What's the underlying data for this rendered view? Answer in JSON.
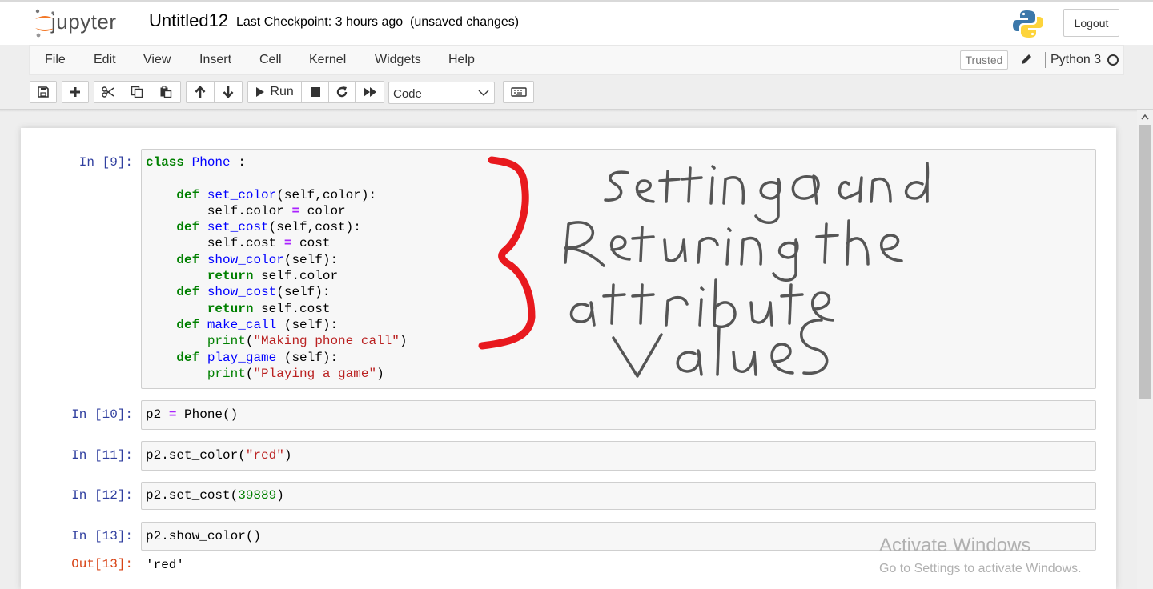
{
  "header": {
    "app_name": "jupyter",
    "notebook_title": "Untitled12",
    "checkpoint_text": "Last Checkpoint: 3 hours ago",
    "unsaved_text": "(unsaved changes)",
    "logout_label": "Logout"
  },
  "menu": {
    "items": [
      "File",
      "Edit",
      "View",
      "Insert",
      "Cell",
      "Kernel",
      "Widgets",
      "Help"
    ],
    "trusted_label": "Trusted",
    "kernel_name": "Python 3"
  },
  "toolbar": {
    "run_label": "Run",
    "cell_type": "Code",
    "icons": [
      "save-icon",
      "plus-icon",
      "scissors-icon",
      "copy-icon",
      "paste-icon",
      "arrow-up-icon",
      "arrow-down-icon",
      "play-icon",
      "stop-icon",
      "restart-icon",
      "fast-forward-icon",
      "keyboard-icon"
    ]
  },
  "cells": [
    {
      "prompt": "In [9]:",
      "code": [
        "class Phone :",
        "",
        "    def set_color(self,color):",
        "        self.color = color",
        "    def set_cost(self,cost):",
        "        self.cost = cost",
        "    def show_color(self):",
        "        return self.color",
        "    def show_cost(self):",
        "        return self.cost",
        "    def make_call (self):",
        "        print(\"Making phone call\")",
        "    def play_game (self):",
        "        print(\"Playing a game\")"
      ]
    },
    {
      "prompt": "In [10]:",
      "code": [
        "p2 = Phone()"
      ]
    },
    {
      "prompt": "In [11]:",
      "code": [
        "p2.set_color(\"red\")"
      ]
    },
    {
      "prompt": "In [12]:",
      "code": [
        "p2.set_cost(39889)"
      ]
    },
    {
      "prompt": "In [13]:",
      "code": [
        "p2.show_color()"
      ],
      "output_prompt": "Out[13]:",
      "output": "'red'"
    }
  ],
  "annotation": {
    "handwriting_lines": [
      "setting and",
      "Returning the",
      "attribute",
      "Values"
    ],
    "brace_color": "#e8191e",
    "ink_color": "#555555"
  },
  "watermark": {
    "title": "Activate Windows",
    "subtitle": "Go to Settings to activate Windows."
  },
  "colors": {
    "keyword": "#008000",
    "function_name": "#0000ff",
    "string": "#ba2121",
    "operator": "#aa22ff",
    "in_prompt": "#303f9f",
    "out_prompt": "#d84315"
  }
}
